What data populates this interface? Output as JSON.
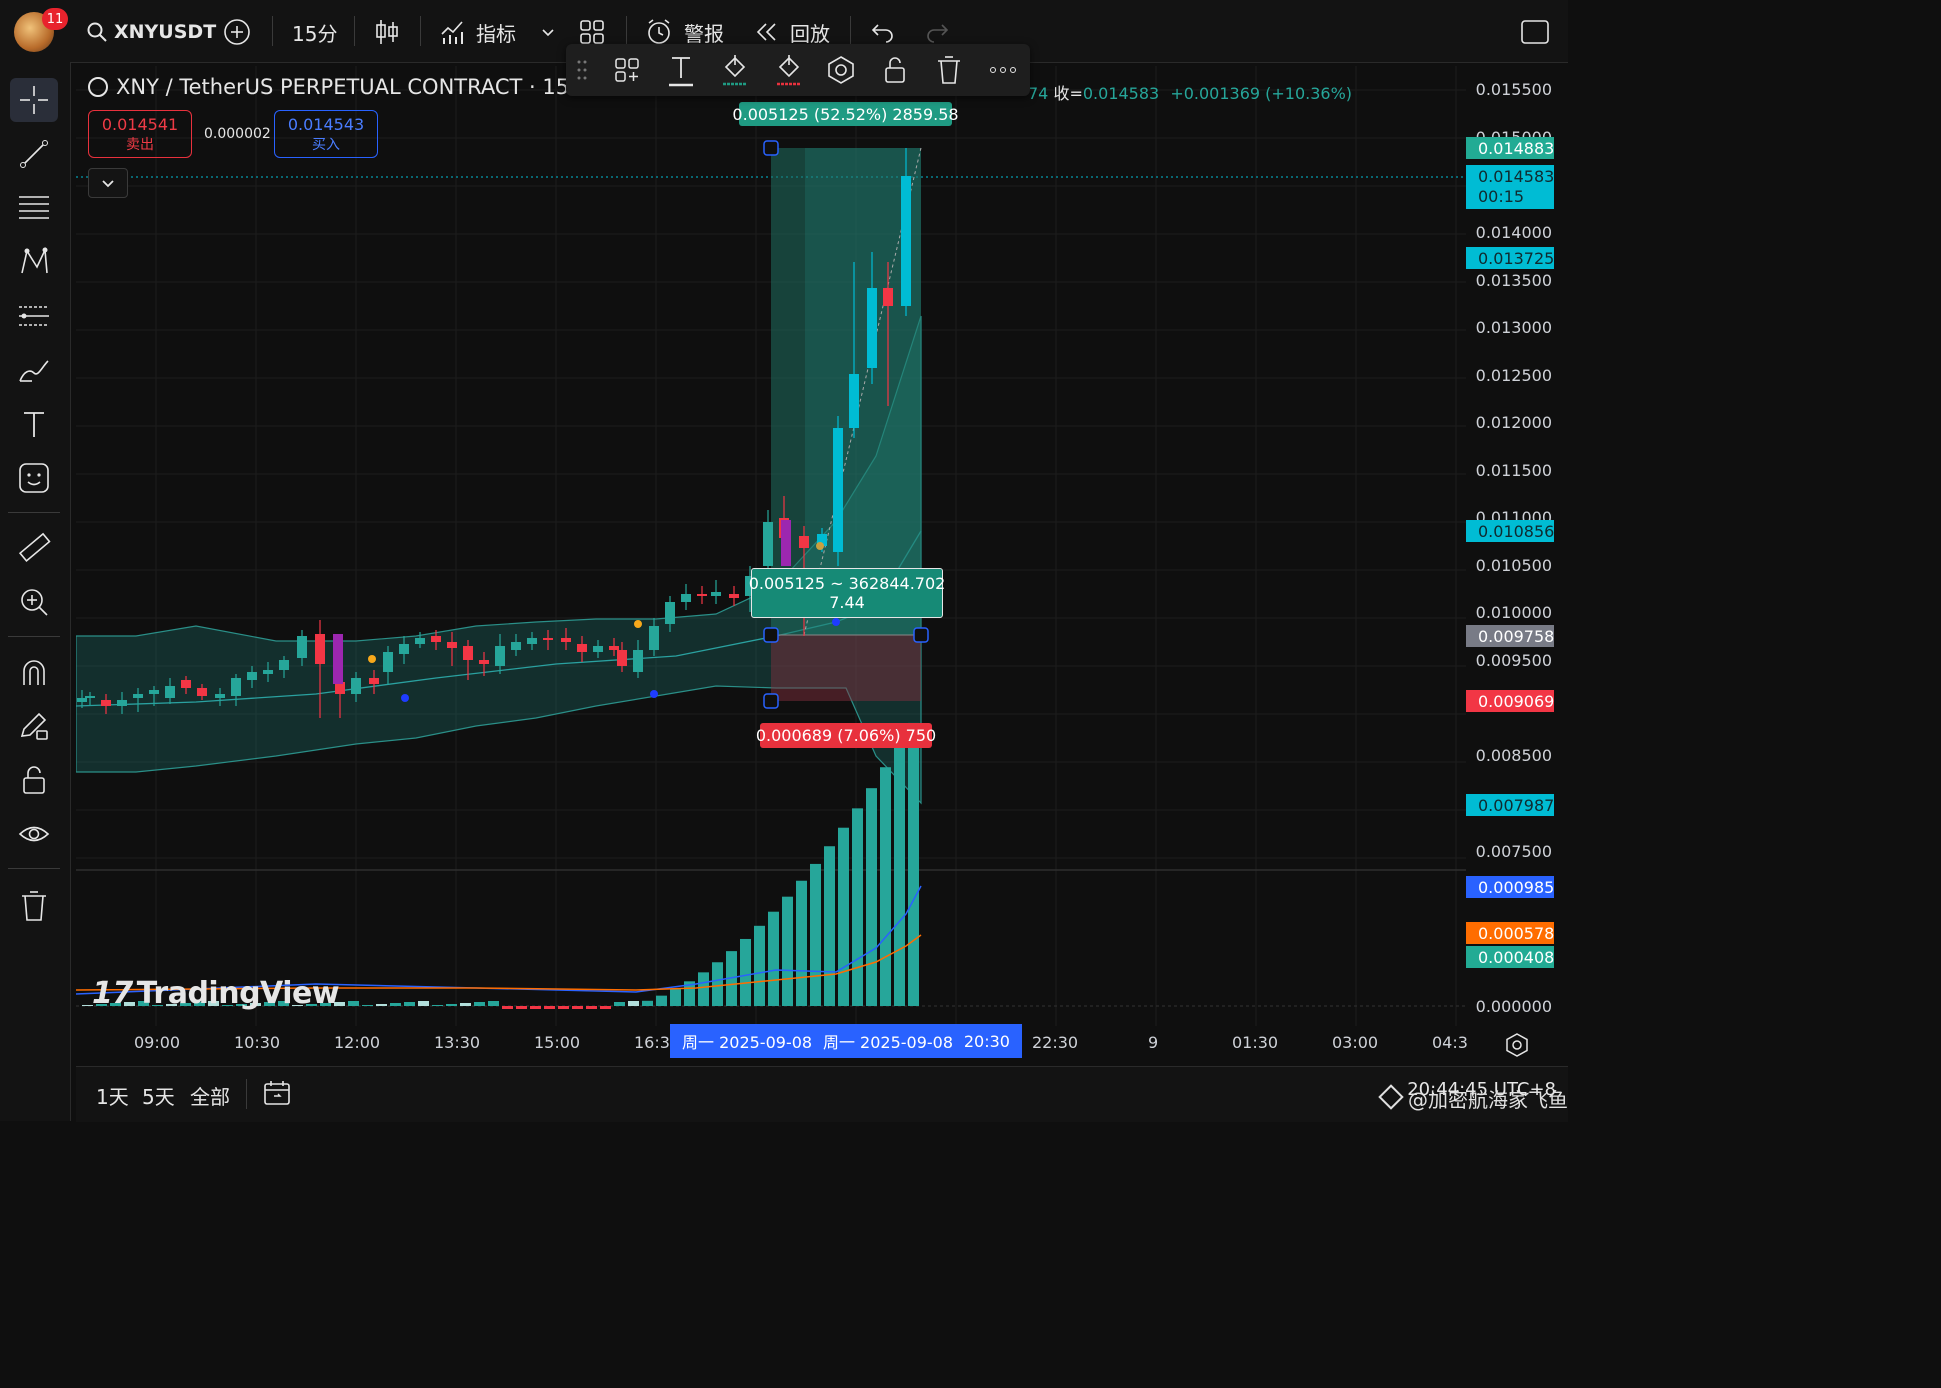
{
  "header": {
    "notification_count": "11",
    "symbol": "XNYUSDT",
    "interval": "15分",
    "indicators_label": "指标",
    "alert_label": "警报",
    "replay_label": "回放"
  },
  "chart_title": "XNY / TetherUS PERPETUAL CONTRACT · 15 ·",
  "ohlc": {
    "prefix": "74",
    "close_label": "收=",
    "close": "0.014583",
    "change": "+0.001369 (+10.36%)"
  },
  "trade": {
    "sell_price": "0.014541",
    "sell_label": "卖出",
    "spread": "0.000002",
    "buy_price": "0.014543",
    "buy_label": "买入"
  },
  "position_tool": {
    "target_label": "0.005125 (52.52%) 2859.58",
    "center_label_line1": "0.005125 ~ 362844.702",
    "center_label_line2": "7.44",
    "stop_label": "0.000689 (7.06%) 750"
  },
  "price_axis": {
    "ticks": [
      "0.015500",
      "0.015000",
      "0.014000",
      "0.013500",
      "0.013000",
      "0.012500",
      "0.012000",
      "0.011500",
      "0.011000",
      "0.010500",
      "0.010000",
      "0.009500",
      "0.008500",
      "0.007500",
      "0.000000"
    ],
    "labels": [
      {
        "text": "0.014883",
        "color": "#22ab94"
      },
      {
        "text": "0.014583",
        "sub": "00:15",
        "color": "#00bcd4"
      },
      {
        "text": "0.013725",
        "color": "#00bcd4"
      },
      {
        "text": "0.010856",
        "color": "#00bcd4"
      },
      {
        "text": "0.009758",
        "color": "#787b86"
      },
      {
        "text": "0.009069",
        "color": "#f23645"
      },
      {
        "text": "0.007987",
        "color": "#00bcd4"
      },
      {
        "text": "0.000985",
        "color": "#2962ff"
      },
      {
        "text": "0.000578",
        "color": "#ff6d00"
      },
      {
        "text": "0.000408",
        "color": "#22ab94"
      }
    ]
  },
  "time_axis": {
    "ticks": [
      "09:00",
      "10:30",
      "12:00",
      "13:30",
      "15:00",
      "16:3",
      "22:30",
      "9",
      "01:30",
      "03:00",
      "04:3"
    ],
    "range_start": "周一 2025-09-08",
    "range_end": "周一 2025-09-08",
    "range_time": "20:30"
  },
  "bottom": {
    "range_1d": "1天",
    "range_5d": "5天",
    "range_all": "全部",
    "clock": "20:44:45 UTC+8"
  },
  "logo_text": "TradingView",
  "watermark": "@加密航海家飞鱼",
  "colors": {
    "up": "#26a69a",
    "up_alt": "#00bcd4",
    "down": "#f23645",
    "target_zone": "#1f6f60",
    "stop_zone": "#5a2f36",
    "macd_line": "#2962ff",
    "signal_line": "#ff6d00"
  }
}
